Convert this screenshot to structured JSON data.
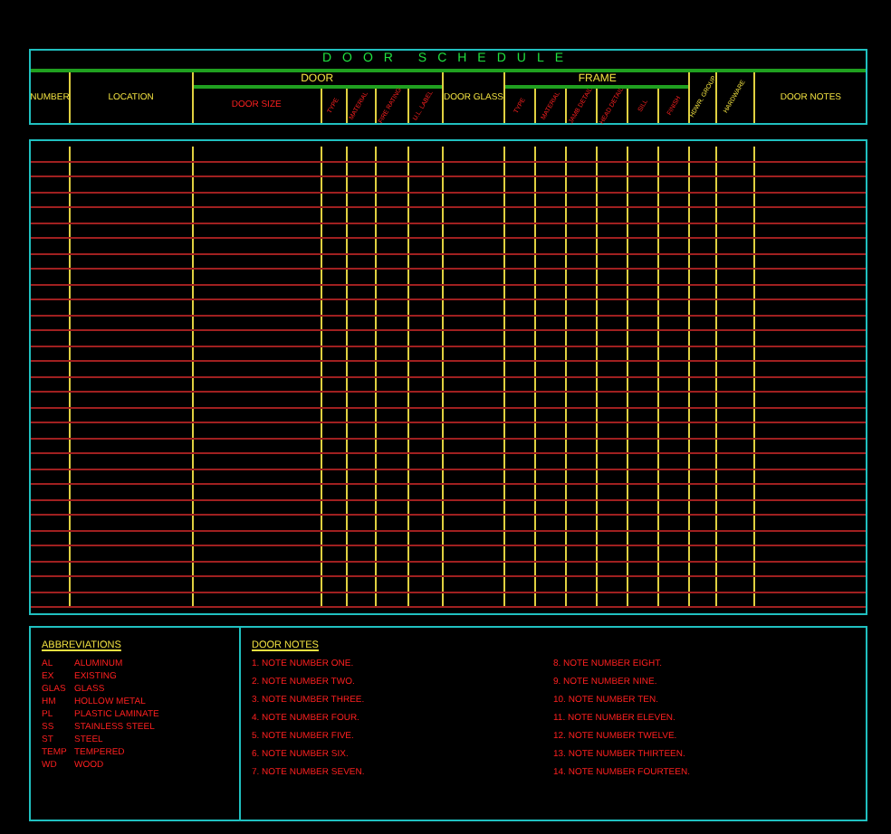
{
  "title": "DOOR SCHEDULE",
  "columns": [
    {
      "kind": "plain",
      "label": "NUMBER"
    },
    {
      "kind": "plain",
      "label": "LOCATION"
    },
    {
      "kind": "group",
      "label": "DOOR",
      "children": [
        {
          "kind": "flat",
          "label": "DOOR SIZE"
        },
        {
          "kind": "rotated",
          "label": "TYPE"
        },
        {
          "kind": "rotated",
          "label": "MATERIAL"
        },
        {
          "kind": "rotated",
          "label": "FIRE RATING"
        },
        {
          "kind": "rotated",
          "label": "U.L. LABEL"
        }
      ]
    },
    {
      "kind": "plain",
      "label": "DOOR GLASS"
    },
    {
      "kind": "group",
      "label": "FRAME",
      "children": [
        {
          "kind": "rotated",
          "label": "TYPE"
        },
        {
          "kind": "rotated",
          "label": "MATERIAL"
        },
        {
          "kind": "rotated",
          "label": "JAMB DETAIL"
        },
        {
          "kind": "rotated",
          "label": "HEAD DETAIL"
        },
        {
          "kind": "rotated",
          "label": "SILL"
        },
        {
          "kind": "rotated",
          "label": "FINISH"
        }
      ]
    },
    {
      "kind": "rotated-plain",
      "label": "HDWR. GROUP"
    },
    {
      "kind": "rotated-plain",
      "label": "HARDWARE"
    },
    {
      "kind": "plain",
      "label": "DOOR NOTES"
    }
  ],
  "abbreviations": {
    "title": "ABBREVIATIONS",
    "items": [
      {
        "code": "AL",
        "meaning": "ALUMINUM"
      },
      {
        "code": "EX",
        "meaning": "EXISTING"
      },
      {
        "code": "GLAS",
        "meaning": "GLASS"
      },
      {
        "code": "HM",
        "meaning": "HOLLOW METAL"
      },
      {
        "code": "PL",
        "meaning": "PLASTIC LAMINATE"
      },
      {
        "code": "SS",
        "meaning": "STAINLESS STEEL"
      },
      {
        "code": "ST",
        "meaning": "STEEL"
      },
      {
        "code": "TEMP",
        "meaning": "TEMPERED"
      },
      {
        "code": "WD",
        "meaning": "WOOD"
      }
    ]
  },
  "door_notes": {
    "title": "DOOR NOTES",
    "items": [
      "1. NOTE NUMBER ONE.",
      "2. NOTE NUMBER TWO.",
      "3. NOTE NUMBER THREE.",
      "4. NOTE NUMBER FOUR.",
      "5. NOTE NUMBER FIVE.",
      "6. NOTE NUMBER SIX.",
      "7. NOTE NUMBER SEVEN.",
      "8. NOTE NUMBER EIGHT.",
      "9. NOTE NUMBER NINE.",
      "10. NOTE NUMBER TEN.",
      "11. NOTE NUMBER ELEVEN.",
      "12. NOTE NUMBER TWELVE.",
      "13. NOTE NUMBER THIRTEEN.",
      "14. NOTE NUMBER FOURTEEN."
    ]
  }
}
